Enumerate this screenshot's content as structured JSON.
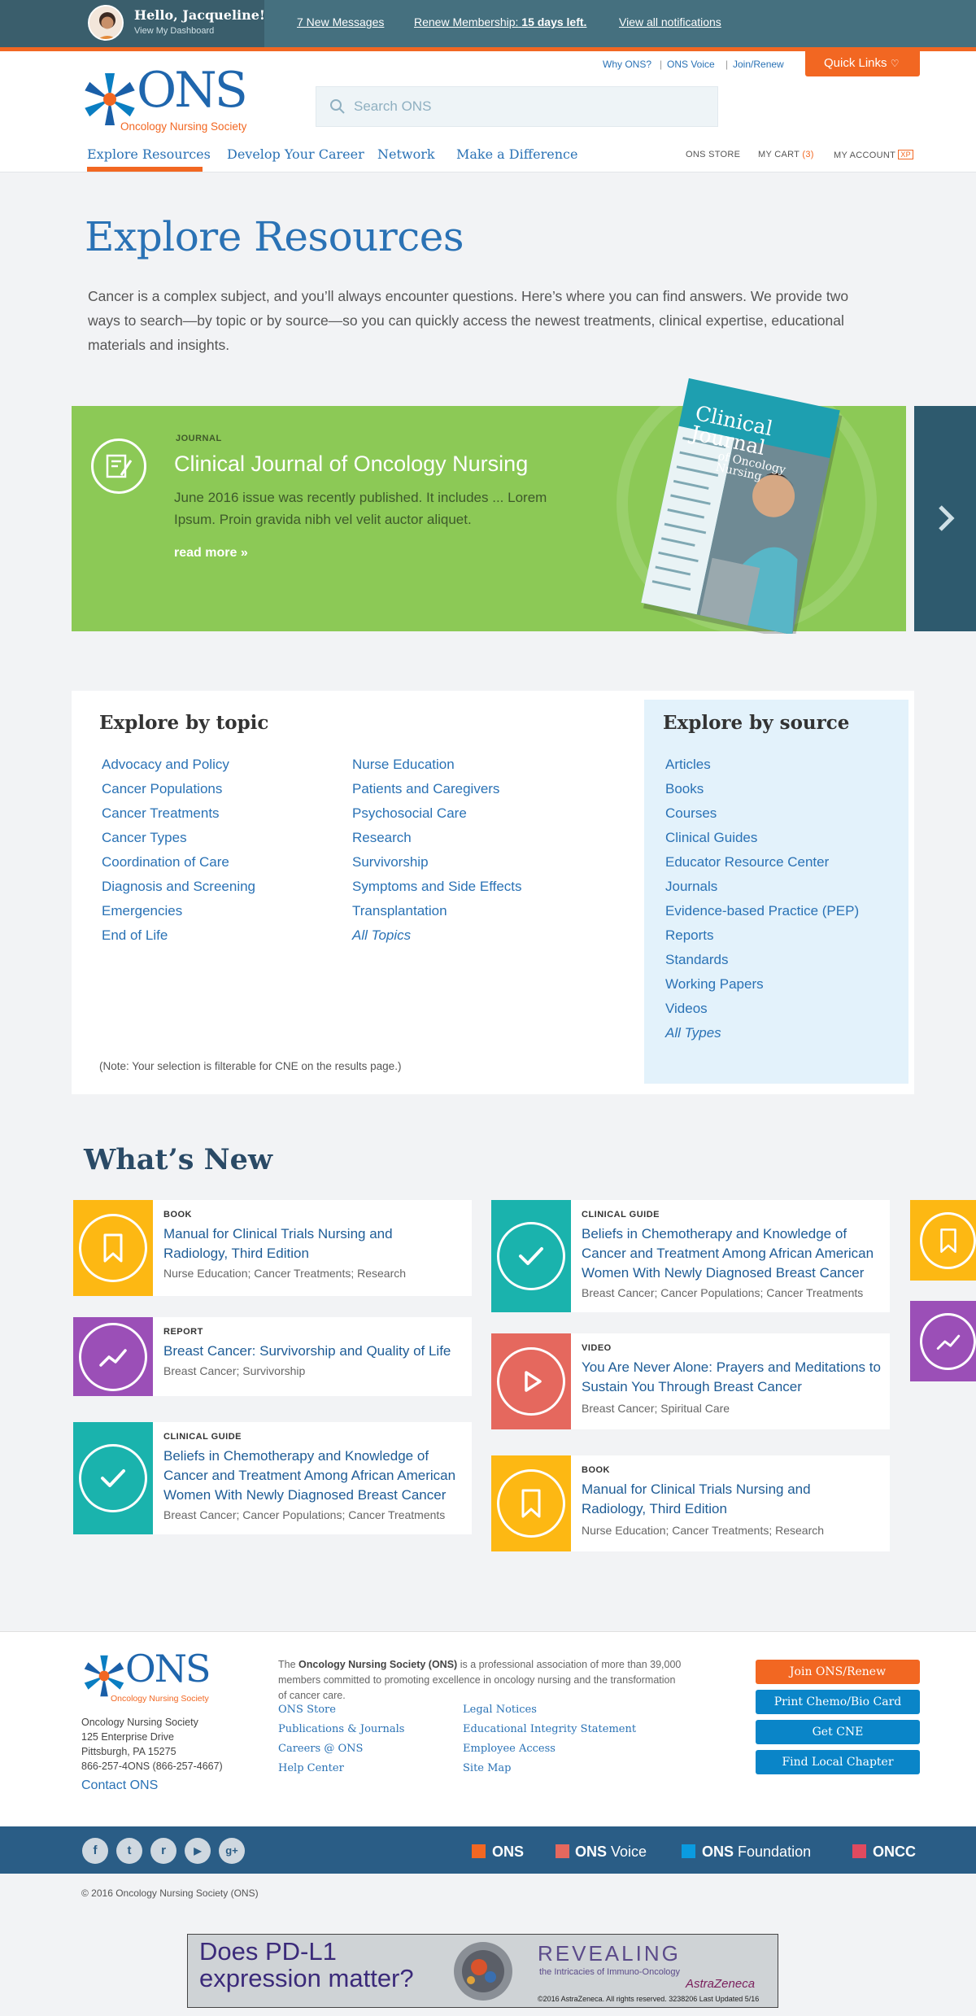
{
  "topbar": {
    "greeting": "Hello, Jacqueline!",
    "dashboard_link": "View My Dashboard",
    "messages": "7 New Messages",
    "renew_prefix": "Renew Membership:",
    "renew_days": "15 days left.",
    "notifications": "View all notifications"
  },
  "header": {
    "util_links": [
      "Why ONS?",
      "ONS Voice",
      "Join/Renew"
    ],
    "quick_links": "Quick Links",
    "logo_text": "ONS",
    "logo_tagline": "Oncology Nursing Society",
    "search_placeholder": "Search ONS",
    "nav": [
      "Explore Resources",
      "Develop Your Career",
      "Network",
      "Make a Difference"
    ],
    "store": "ONS STORE",
    "cart_label": "MY CART",
    "cart_count": "(3)",
    "account": "MY ACCOUNT"
  },
  "hero": {
    "title": "Explore Resources",
    "text": "Cancer is a complex subject, and you’ll always encounter questions. Here’s where you can find answers. We provide two ways to search—by topic or by source—so you can quickly access the newest treatments, clinical expertise, educational materials and insights."
  },
  "feature": {
    "kicker": "JOURNAL",
    "title": "Clinical Journal of Oncology Nursing",
    "desc": "June 2016 issue was recently published. It includes ... Lorem Ipsum. Proin gravida nibh vel velit auctor aliquet.",
    "more": "read more »",
    "cover_title_1": "Clinical Journal",
    "cover_title_2": "of Oncology Nursing"
  },
  "explore": {
    "topic_heading": "Explore by topic",
    "topics_col1": [
      "Advocacy and Policy",
      "Cancer Populations",
      "Cancer Treatments",
      "Cancer Types",
      "Coordination of Care",
      "Diagnosis and Screening",
      "Emergencies",
      "End of Life"
    ],
    "topics_col2": [
      "Nurse Education",
      "Patients and Caregivers",
      "Psychosocial Care",
      "Research",
      "Survivorship",
      "Symptoms and Side Effects",
      "Transplantation",
      "All Topics"
    ],
    "note": "(Note: Your selection is filterable for CNE on the results page.)",
    "source_heading": "Explore by source",
    "sources": [
      "Articles",
      "Books",
      "Courses",
      "Clinical Guides",
      "Educator Resource Center",
      "Journals",
      "Evidence-based Practice (PEP)",
      "Reports",
      "Standards",
      "Working Papers",
      "Videos",
      "All Types"
    ]
  },
  "whats_new": {
    "heading": "What’s New",
    "cards": [
      {
        "kicker": "BOOK",
        "title": "Manual for Clinical Trials Nursing and Radiology, Third Edition",
        "tags": "Nurse Education; Cancer Treatments; Research",
        "color": "#fdb813",
        "icon": "bookmark-icon"
      },
      {
        "kicker": "REPORT",
        "title": "Breast Cancer: Survivorship and Quality of Life",
        "tags": "Breast Cancer; Survivorship",
        "color": "#9b4fb7",
        "icon": "trend-icon"
      },
      {
        "kicker": "CLINICAL GUIDE",
        "title": "Beliefs in Chemotherapy and Knowledge of Cancer and Treatment Among African American Women With Newly Diagnosed Breast Cancer",
        "tags": "Breast Cancer; Cancer Populations; Cancer Treatments",
        "color": "#1ab3ad",
        "icon": "check-icon"
      },
      {
        "kicker": "CLINICAL GUIDE",
        "title": "Beliefs in Chemotherapy and Knowledge of Cancer and Treatment Among African American Women With Newly Diagnosed Breast Cancer",
        "tags": "Breast Cancer; Cancer Populations; Cancer Treatments",
        "color": "#1ab3ad",
        "icon": "check-icon"
      },
      {
        "kicker": "VIDEO",
        "title": "You Are Never Alone: Prayers and Meditations to Sustain You Through Breast Cancer",
        "tags": "Breast Cancer; Spiritual Care",
        "color": "#e5685e",
        "icon": "play-icon"
      },
      {
        "kicker": "BOOK",
        "title": "Manual for Clinical Trials Nursing and Radiology, Third Edition",
        "tags": "Nurse Education; Cancer Treatments; Research",
        "color": "#fdb813",
        "icon": "bookmark-icon"
      }
    ]
  },
  "footer": {
    "logo_text": "ONS",
    "logo_tagline": "Oncology Nursing Society",
    "address": [
      "Oncology Nursing Society",
      "125 Enterprise Drive",
      "Pittsburgh, PA 15275",
      "866-257-4ONS (866-257-4667)"
    ],
    "contact": "Contact ONS",
    "about_prefix": "The",
    "about_org": "Oncology Nursing Society (ONS)",
    "about_rest": "is a professional association of more than 39,000 members committed to promoting excellence in oncology nursing and the transformation of cancer care.",
    "links_col1": [
      "ONS Store",
      "Publications & Journals",
      "Careers @ ONS",
      "Help Center"
    ],
    "links_col2": [
      "Legal Notices",
      "Educational Integrity Statement",
      "Employee Access",
      "Site Map"
    ],
    "buttons": [
      "Join ONS/Renew",
      "Print Chemo/Bio Card",
      "Get CNE",
      "Find Local Chapter"
    ],
    "button_colors": [
      "#f26722",
      "#0a85c8",
      "#0a85c8",
      "#0a85c8"
    ],
    "social": [
      "f",
      "t",
      "r",
      "▶",
      "g+"
    ],
    "brands": [
      {
        "bold": "ONS",
        "light": "",
        "color": "#f26722"
      },
      {
        "bold": "ONS",
        "light": " Voice",
        "color": "#e5685e"
      },
      {
        "bold": "ONS",
        "light": " Foundation",
        "color": "#0a9be0"
      },
      {
        "bold": "ONCC",
        "light": "",
        "color": "#e04a5f"
      }
    ],
    "copyright": "© 2016 Oncology Nursing Society (ONS)"
  },
  "ad": {
    "headline_1": "Does PD-L1",
    "headline_2": "expression matter?",
    "revealing": "REVEALING",
    "revealing_sub": "the Intricacies of Immuno-Oncology",
    "brand": "AstraZeneca",
    "legal": "©2016 AstraZeneca. All rights reserved.   3238206  Last Updated 5/16"
  }
}
